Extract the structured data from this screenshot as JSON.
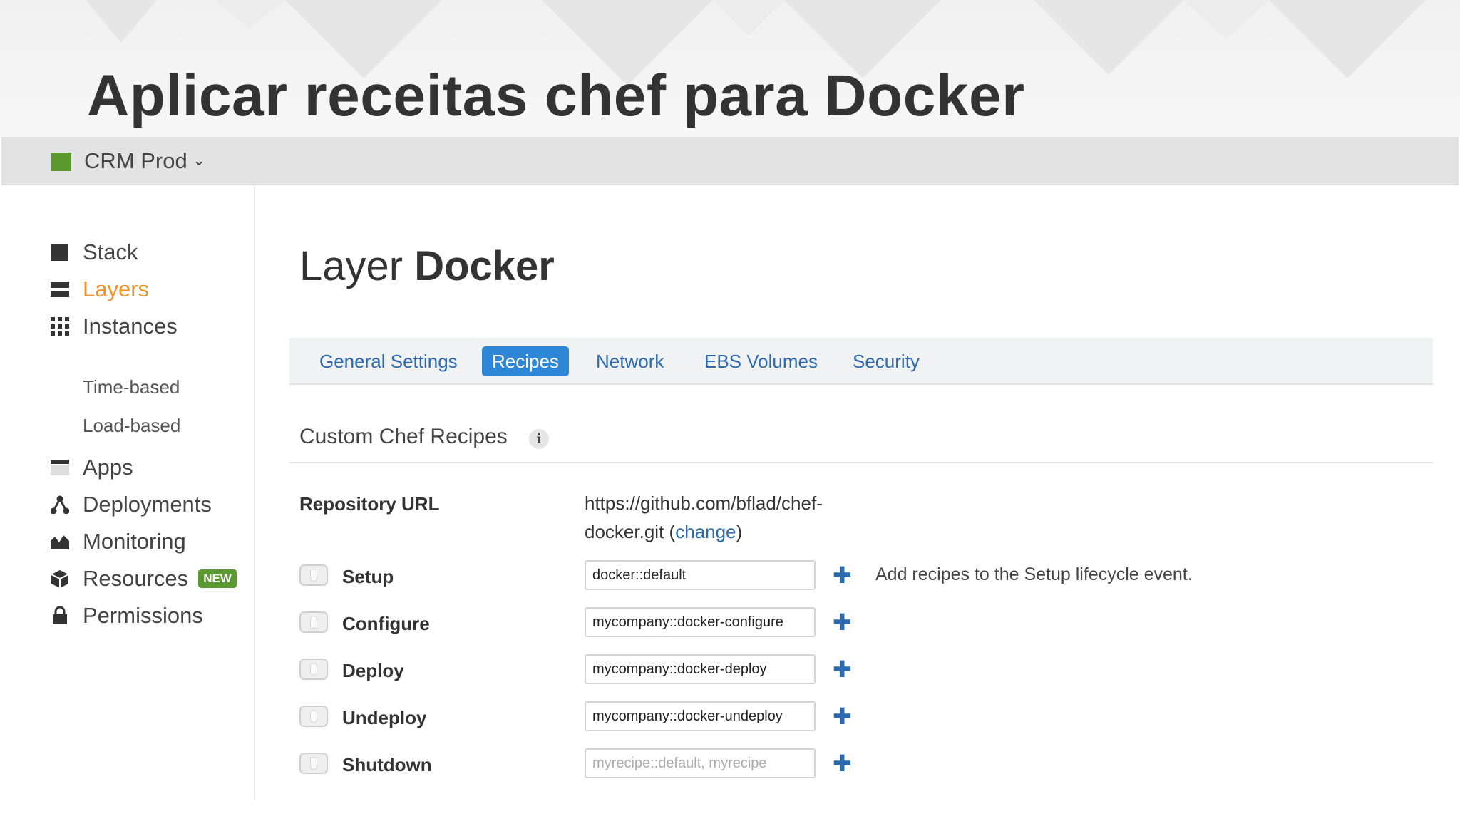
{
  "slide": {
    "title": "Aplicar receitas chef para Docker"
  },
  "topbar": {
    "stack_name": "CRM Prod",
    "caret": "⌄",
    "swatch_color": "#5d9732"
  },
  "sidebar": {
    "items": [
      {
        "label": "Stack",
        "icon": "stack-icon"
      },
      {
        "label": "Layers",
        "icon": "layers-icon",
        "active": true
      },
      {
        "label": "Instances",
        "icon": "instances-grid-icon"
      },
      {
        "label": "Time-based"
      },
      {
        "label": "Load-based"
      },
      {
        "label": "Apps",
        "icon": "apps-icon"
      },
      {
        "label": "Deployments",
        "icon": "deployments-icon"
      },
      {
        "label": "Monitoring",
        "icon": "monitoring-icon"
      },
      {
        "label": "Resources",
        "icon": "resources-icon",
        "badge": "NEW"
      },
      {
        "label": "Permissions",
        "icon": "lock-icon"
      }
    ],
    "active_color": "#f0942a"
  },
  "main": {
    "title_prefix": "Layer",
    "title_name": "Docker",
    "tabs": [
      {
        "label": "General Settings"
      },
      {
        "label": "Recipes",
        "active": true
      },
      {
        "label": "Network"
      },
      {
        "label": "EBS Volumes"
      },
      {
        "label": "Security"
      }
    ],
    "section_title": "Custom Chef Recipes",
    "info_glyph": "i",
    "repository": {
      "label": "Repository URL",
      "url": "https://github.com/bflad/chef-docker.git",
      "change_label": "change"
    },
    "rows": [
      {
        "label": "Setup",
        "value": "docker::default",
        "placeholder": ""
      },
      {
        "label": "Configure",
        "value": "mycompany::docker-configure",
        "placeholder": ""
      },
      {
        "label": "Deploy",
        "value": "mycompany::docker-deploy",
        "placeholder": ""
      },
      {
        "label": "Undeploy",
        "value": "mycompany::docker-undeploy",
        "placeholder": ""
      },
      {
        "label": "Shutdown",
        "value": "",
        "placeholder": "myrecipe::default, myrecipe"
      }
    ],
    "add_glyph": "✚",
    "setup_help": "Add recipes to the Setup lifecycle event.",
    "toggle_glyph": "0",
    "accent_color": "#2e86d6"
  }
}
